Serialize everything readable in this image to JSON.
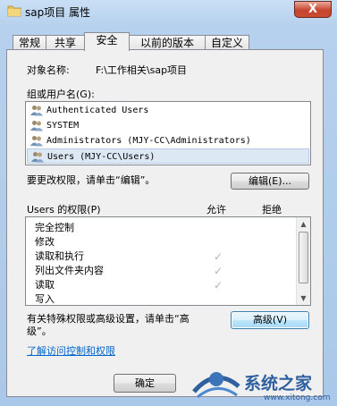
{
  "window": {
    "title": "sap项目 属性",
    "close_label": "X"
  },
  "tabs": [
    {
      "label": "常规"
    },
    {
      "label": "共享"
    },
    {
      "label": "安全",
      "active": true
    },
    {
      "label": "以前的版本"
    },
    {
      "label": "自定义"
    }
  ],
  "object": {
    "label": "对象名称:",
    "value": "F:\\工作相关\\sap项目"
  },
  "groups": {
    "label": "组或用户名(G):",
    "items": [
      {
        "name": "Authenticated Users",
        "icon": "users-group-icon",
        "selected": false
      },
      {
        "name": "SYSTEM",
        "icon": "users-group-icon",
        "selected": false
      },
      {
        "name": "Administrators (MJY-CC\\Administrators)",
        "icon": "users-group-icon",
        "selected": false
      },
      {
        "name": "Users (MJY-CC\\Users)",
        "icon": "users-group-icon",
        "selected": true
      }
    ]
  },
  "change_perm": {
    "hint": "要更改权限，请单击“编辑”。",
    "edit_button": "编辑(E)..."
  },
  "permissions": {
    "title": "Users 的权限(P)",
    "allow_header": "允许",
    "deny_header": "拒绝",
    "rows": [
      {
        "name": "完全控制",
        "allow": false,
        "deny": false
      },
      {
        "name": "修改",
        "allow": false,
        "deny": false
      },
      {
        "name": "读取和执行",
        "allow": true,
        "deny": false
      },
      {
        "name": "列出文件夹内容",
        "allow": true,
        "deny": false
      },
      {
        "name": "读取",
        "allow": true,
        "deny": false
      },
      {
        "name": "写入",
        "allow": false,
        "deny": false
      }
    ]
  },
  "advanced": {
    "hint_line1": "有关特殊权限或高级设置，请单击“高",
    "hint_line2": "级”。",
    "button": "高级(V)"
  },
  "learn_link": "了解访问控制和权限",
  "ok_button": "确定",
  "watermark": {
    "text": "系统之家",
    "sub": "www.xitong.com"
  },
  "colors": {
    "link": "#0066cc",
    "close_button": "#c7452f",
    "selection": "#dde8f5"
  }
}
